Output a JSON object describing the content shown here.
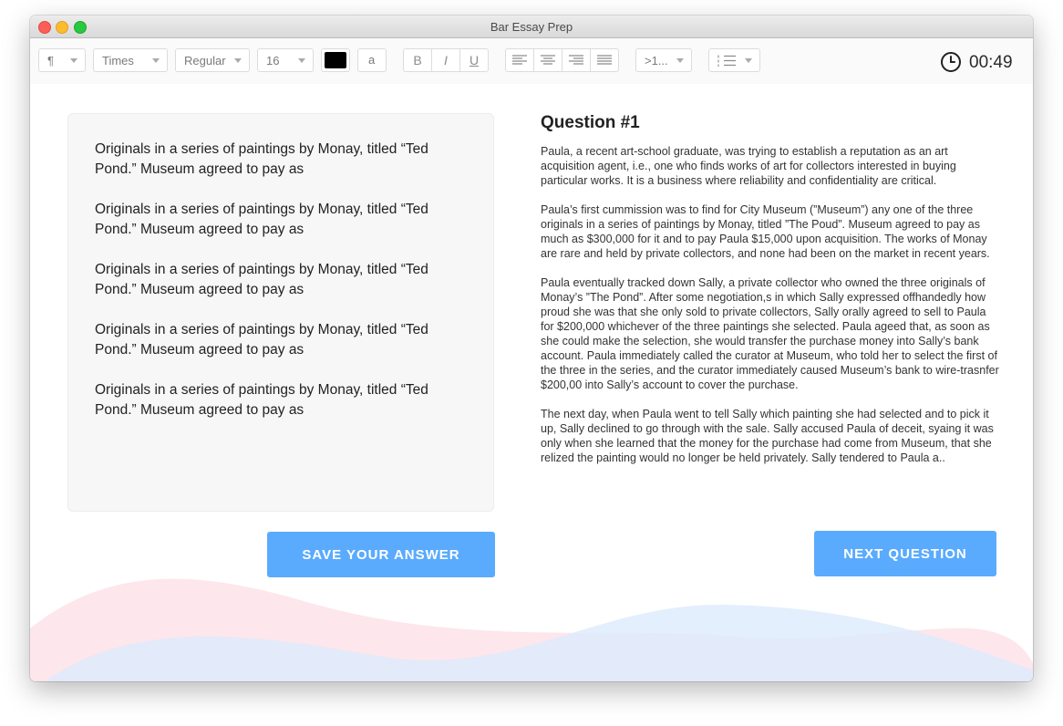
{
  "window": {
    "title": "Bar Essay Prep"
  },
  "toolbar": {
    "paragraph_style": "¶",
    "font_family": "Times",
    "font_weight": "Regular",
    "font_size": "16",
    "text_color": "#000000",
    "highlight_label": "a",
    "bold_label": "B",
    "italic_label": "I",
    "underline_label": "U",
    "indent_label": ">1...",
    "icons": {
      "align": [
        "align-left-icon",
        "align-center-icon",
        "align-right-icon",
        "align-justify-icon"
      ],
      "list": "numbered-list-icon",
      "timer": "clock-icon"
    }
  },
  "timer": {
    "value": "00:49"
  },
  "answer": {
    "paragraphs": [
      "Originals in a series of paintings by Monay, titled “Ted Pond.” Museum agreed to pay as",
      "Originals in a series of paintings by Monay, titled “Ted Pond.” Museum agreed to pay as",
      "Originals in a series of paintings by Monay, titled “Ted Pond.” Museum agreed to pay as",
      "Originals in a series of paintings by Monay, titled “Ted Pond.” Museum agreed to pay as",
      "Originals in a series of paintings by Monay, titled “Ted Pond.” Museum agreed to pay as"
    ]
  },
  "question": {
    "title": "Question #1",
    "paragraphs": [
      "Paula, a recent art-school graduate, was trying to establish a reputation as an art acquisition agent, i.e., one who finds works of art for collectors interested in buying particular works. It is a business where reliability and confidentiality are critical.",
      "Paula’s first cummission was to find for City Museum (”Museum”) any one of the three originals in a series of paintings by Monay, titled ”The Poud”. Museum agreed to pay as much as $300,000 for it and to pay Paula $15,000 upon acquisition. The works of Monay are rare and held by private collectors, and none had been on the market in recent years.",
      "Paula eventually tracked down Sally, a private collector who owned the three originals of Monay’s ”The Pond”. After some negotiation,s in which Sally expressed offhandedly how proud she was that she only sold to private collectors, Sally orally agreed to sell to Paula for $200,000 whichever of the three paintings she selected. Paula ageed that, as soon as she could make the selection, she would transfer the purchase money into Sally’s bank account. Paula immediately called the curator at Museum, who told her to select the first of the three in the series, and the curator immediately caused Museum’s bank to wire-trasnfer $200,00 into Sally’s account to cover the purchase.",
      "The next day, when Paula went to tell Sally which painting she had selected and to pick it up, Sally declined to go through with the sale. Sally accused Paula of deceit, syaing it was only when she learned that the money for the purchase had come from Museum, that she relized the painting would no longer be held privately. Sally tendered to Paula a.."
    ]
  },
  "buttons": {
    "save": "SAVE YOUR ANSWER",
    "next": "NEXT QUESTION"
  },
  "colors": {
    "accent": "#5aabfd",
    "wave_pink": "#fde3ea",
    "wave_blue": "#dcebfd"
  }
}
